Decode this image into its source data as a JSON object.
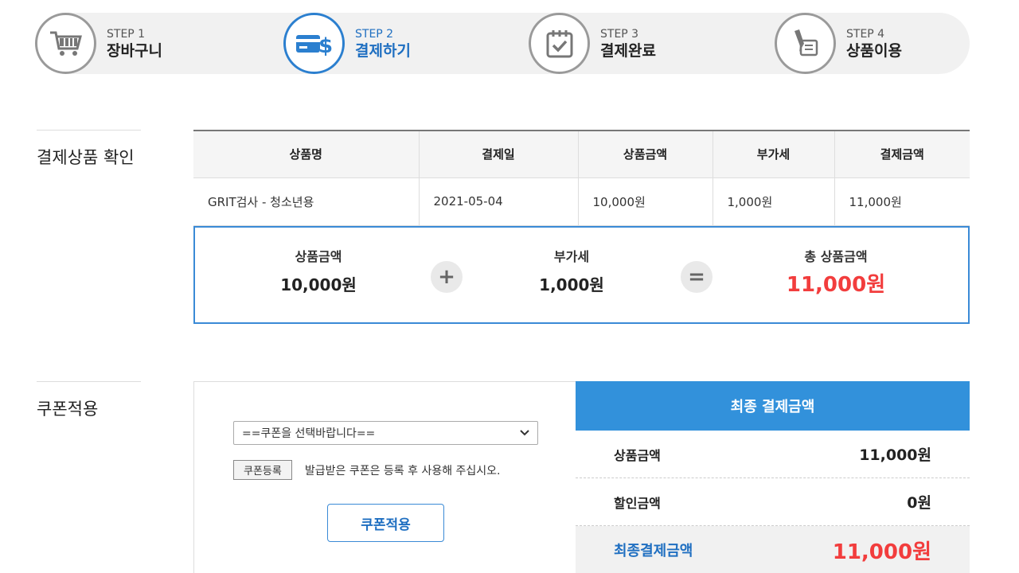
{
  "steps": [
    {
      "num": "STEP 1",
      "label": "장바구니",
      "icon": "cart-icon"
    },
    {
      "num": "STEP 2",
      "label": "결제하기",
      "icon": "card-dollar-icon"
    },
    {
      "num": "STEP 3",
      "label": "결제완료",
      "icon": "calendar-check-icon"
    },
    {
      "num": "STEP 4",
      "label": "상품이용",
      "icon": "pen-document-icon"
    }
  ],
  "colors": {
    "accent": "#3291db",
    "active_text": "#1f6fc1",
    "price_red": "#f23d3d"
  },
  "product_section": {
    "title": "결제상품 확인",
    "headers": [
      "상품명",
      "결제일",
      "상품금액",
      "부가세",
      "결제금액"
    ],
    "row": [
      "GRIT검사 - 청소년용",
      "2021-05-04",
      "10,000원",
      "1,000원",
      "11,000원"
    ]
  },
  "summary": {
    "price_label": "상품금액",
    "price_value": "10,000원",
    "plus": "+",
    "vat_label": "부가세",
    "vat_value": "1,000원",
    "equals": "=",
    "total_label": "총 상품금액",
    "total_value": "11,000원"
  },
  "coupon_section": {
    "title": "쿠폰적용",
    "select_value": "==쿠폰을 선택바랍니다==",
    "register_button": "쿠폰등록",
    "register_note": "발급받은 쿠폰은 등록 후 사용해 주십시오.",
    "apply_button": "쿠폰적용"
  },
  "final": {
    "title": "최종 결제금액",
    "rows": [
      {
        "label": "상품금액",
        "value": "11,000원"
      },
      {
        "label": "할인금액",
        "value": "0원"
      }
    ],
    "total_label": "최종결제금액",
    "total_value": "11,000원"
  }
}
